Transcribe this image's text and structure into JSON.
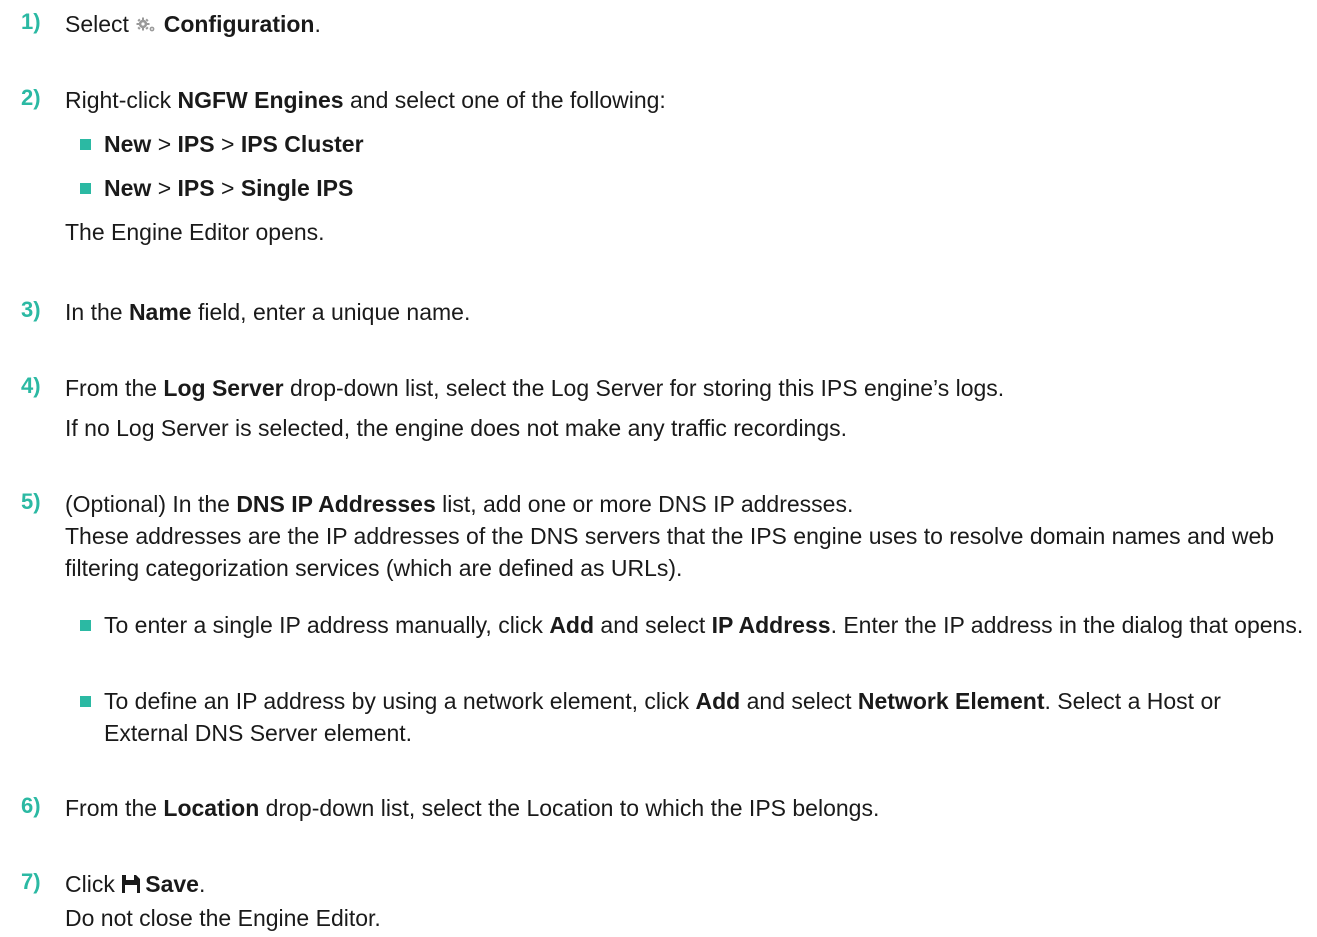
{
  "steps": [
    {
      "num": "1)",
      "prefix": "Select",
      "icon": "gear-icon",
      "bold": "Configuration",
      "suffix": "."
    },
    {
      "num": "2)",
      "pre": "Right-click",
      "bold": "NGFW Engines",
      "post": "and select one of the following:",
      "options": [
        {
          "a": "New",
          "sep1": ">",
          "b": "IPS",
          "sep2": ">",
          "c": "IPS Cluster"
        },
        {
          "a": "New",
          "sep1": ">",
          "b": "IPS",
          "sep2": ">",
          "c": "Single IPS"
        }
      ],
      "result": "The Engine Editor opens."
    },
    {
      "num": "3)",
      "pre": "In the",
      "bold": "Name",
      "post": "field, enter a unique name."
    },
    {
      "num": "4)",
      "pre": "From the",
      "bold": "Log Server",
      "post": "drop-down list, select the Log Server for storing this IPS engine’s logs.",
      "note": "If no Log Server is selected, the engine does not make any traffic recordings."
    },
    {
      "num": "5)",
      "pre": "(Optional) In the",
      "bold": "DNS IP Addresses",
      "post": "list, add one or more DNS IP addresses.",
      "note": "These addresses are the IP addresses of the DNS servers that the IPS engine uses to resolve domain names and web filtering categorization services (which are defined as URLs).",
      "bullets": [
        {
          "t1": "To enter a single IP address manually, click",
          "b1": "Add",
          "t2": "and select",
          "b2": "IP Address",
          "t3": ". Enter the IP address in the dialog that opens."
        },
        {
          "t1": "To define an IP address by using a network element, click",
          "b1": "Add",
          "t2": "and select",
          "b2": "Network Element",
          "t3": ". Select a Host or External DNS Server element."
        }
      ]
    },
    {
      "num": "6)",
      "pre": "From the",
      "bold": "Location",
      "post": "drop-down list, select the Location to which the IPS belongs."
    },
    {
      "num": "7)",
      "pre": "Click",
      "icon": "save-icon",
      "bold": "Save",
      "suffix": ".",
      "note": "Do not close the Engine Editor."
    }
  ],
  "colors": {
    "accent": "#2bb9a3",
    "text": "#1a1a1a",
    "icon_gray": "#9a9a9a"
  }
}
